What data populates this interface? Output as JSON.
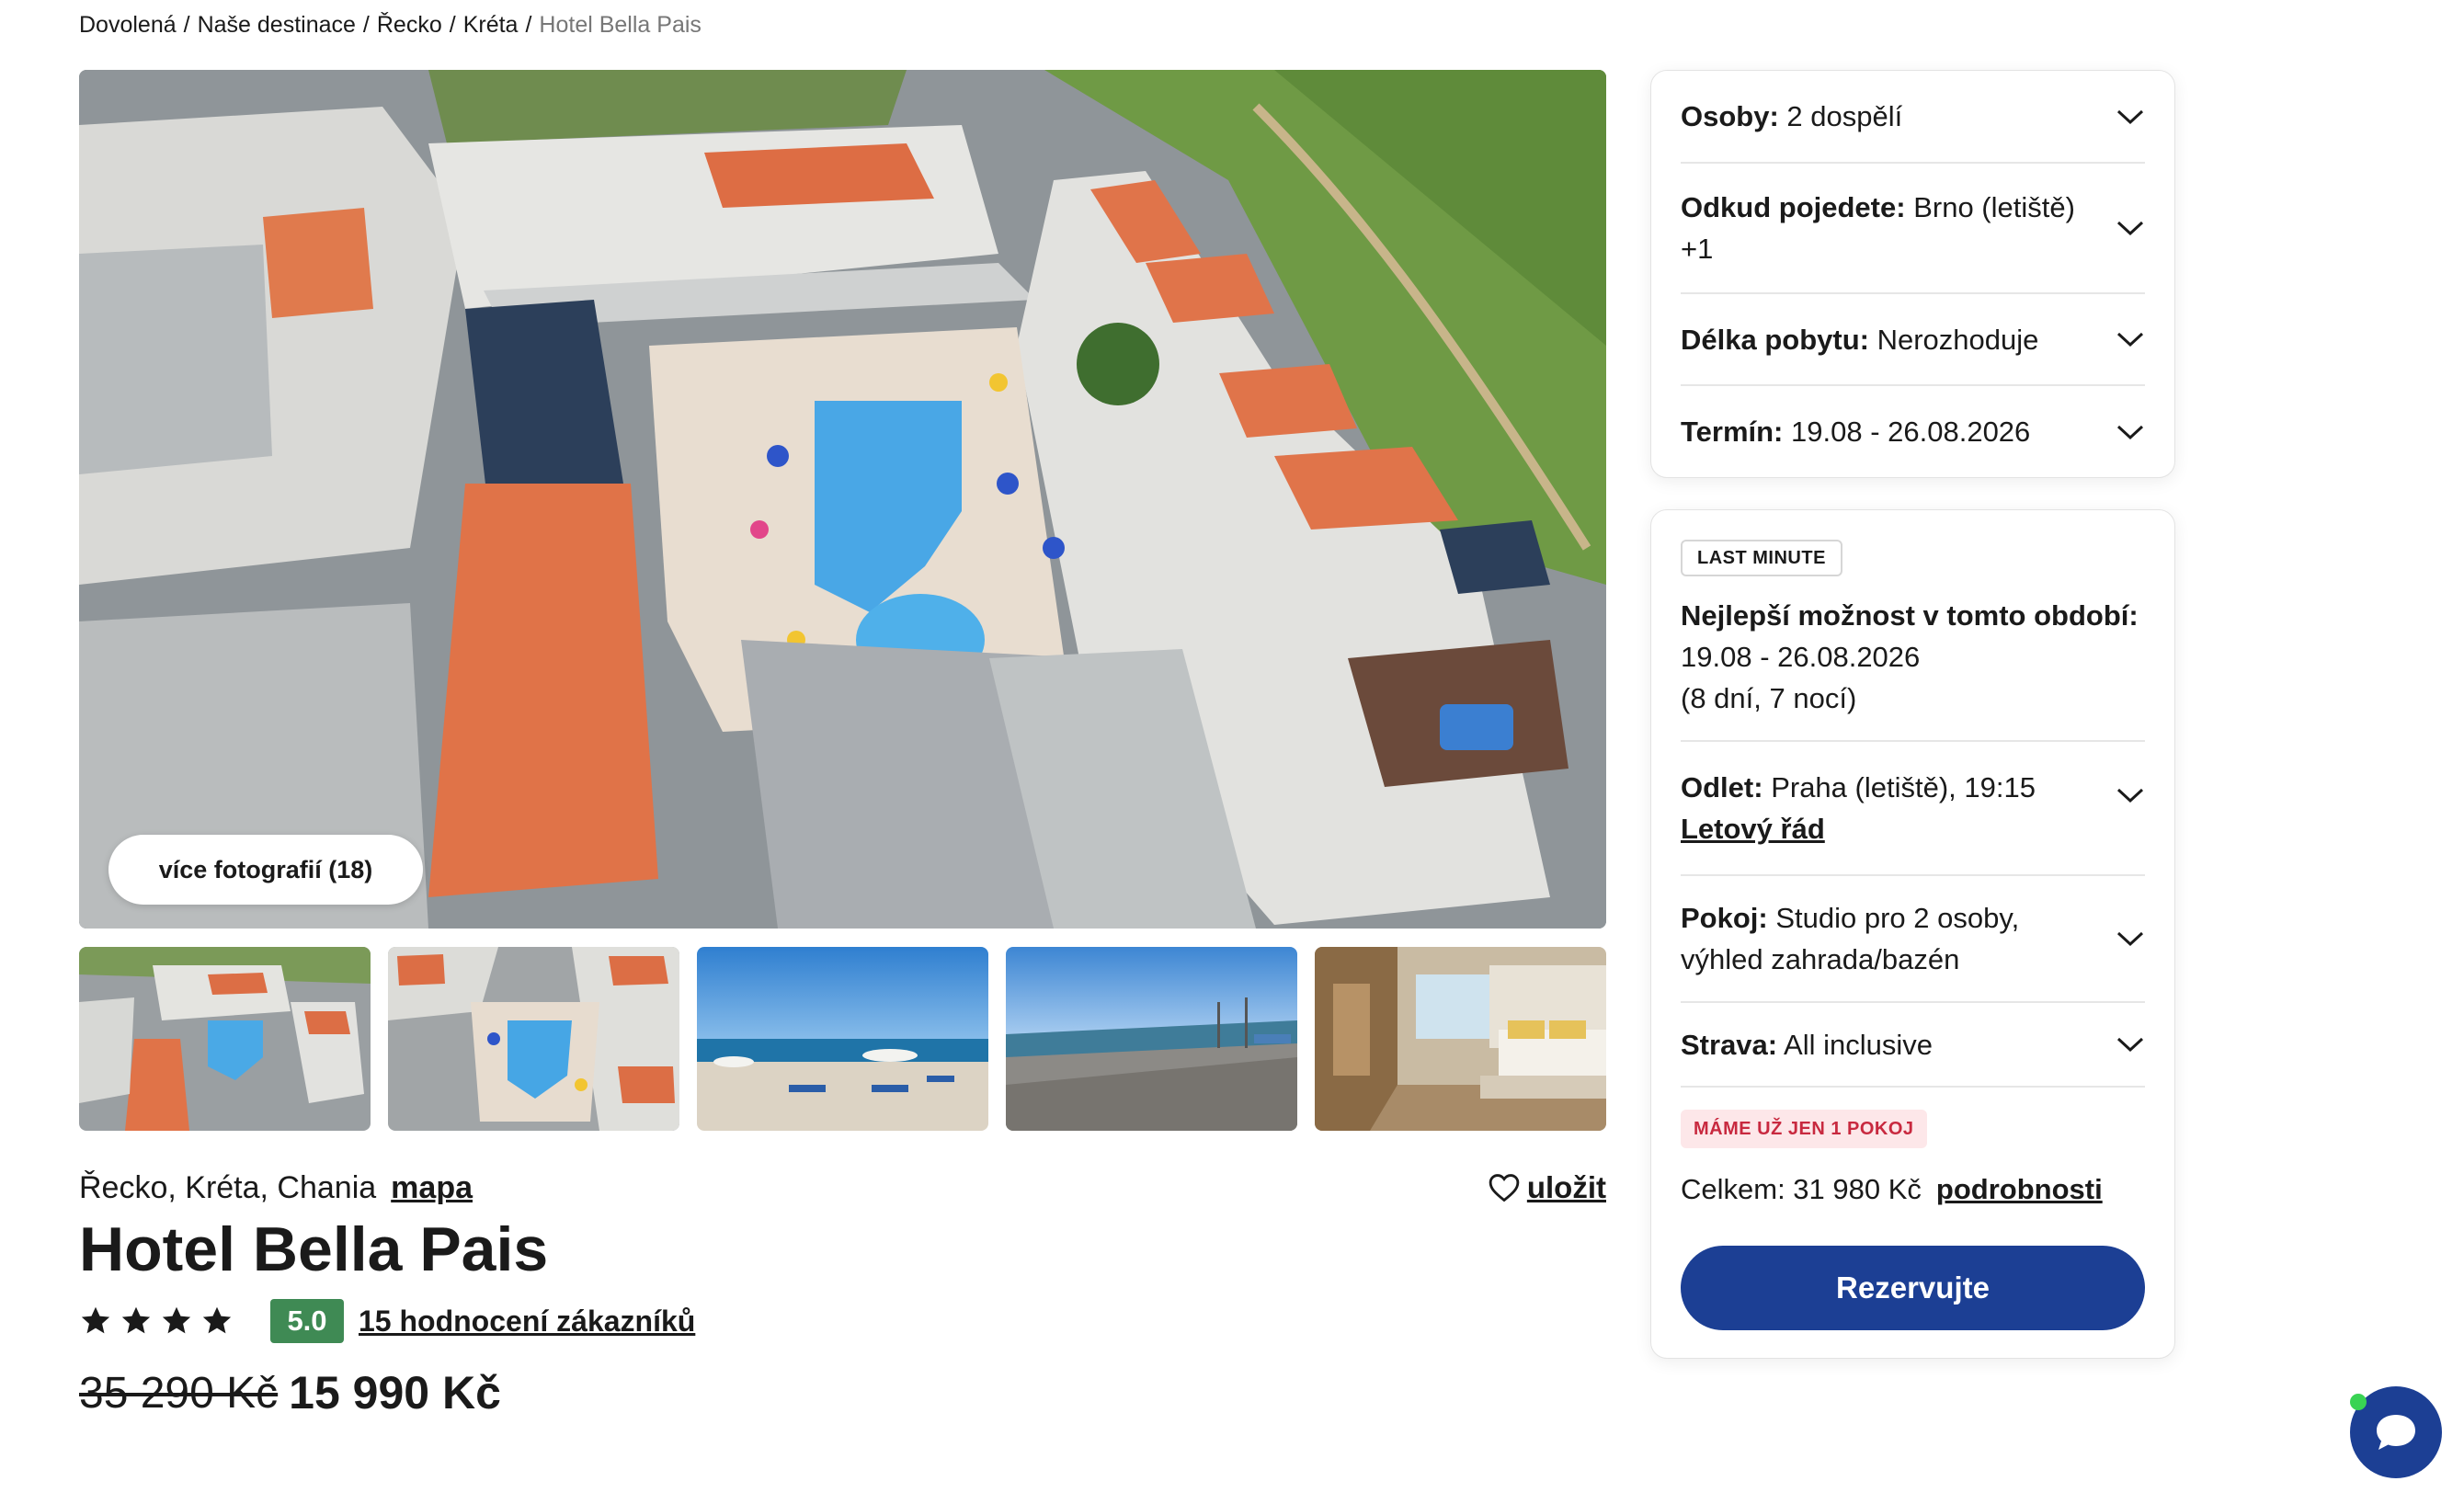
{
  "breadcrumb": [
    "Dovolená",
    "Naše destinace",
    "Řecko",
    "Kréta",
    "Hotel Bella Pais"
  ],
  "gallery": {
    "more_photos_label": "více fotografií (18)",
    "thumbnails": [
      "pool-aerial",
      "pool-aerial-2",
      "beach-umbrellas",
      "pebble-beach",
      "hotel-room"
    ]
  },
  "hotel": {
    "location": "Řecko, Kréta, Chania",
    "map_label": "mapa",
    "save_label": "uložit",
    "name": "Hotel Bella Pais",
    "stars": 4,
    "score": "5.0",
    "reviews_label": "15 hodnocení zákazníků",
    "old_price": "35 290 Kč",
    "new_price": "15 990 Kč"
  },
  "filters": {
    "persons": {
      "label": "Osoby:",
      "value": "2 dospělí"
    },
    "departure": {
      "label": "Odkud pojedete:",
      "value": "Brno (letiště) +1"
    },
    "length": {
      "label": "Délka pobytu:",
      "value": "Nerozhoduje"
    },
    "term": {
      "label": "Termín:",
      "value": "19.08 - 26.08.2026"
    }
  },
  "offer": {
    "badge": "LAST MINUTE",
    "best_label": "Nejlepší možnost v tomto období:",
    "best_dates": "19.08 - 26.08.2026",
    "best_nights": "(8 dní, 7 nocí)",
    "flight": {
      "label": "Odlet:",
      "value": "Praha (letiště), 19:15",
      "link": "Letový řád"
    },
    "room": {
      "label": "Pokoj:",
      "value": "Studio pro 2 osoby, výhled zahrada/bazén"
    },
    "board": {
      "label": "Strava:",
      "value": "All inclusive"
    },
    "rooms_left": "MÁME UŽ JEN 1 POKOJ",
    "total_label": "Celkem: 31 980 Kč",
    "details_label": "podrobnosti",
    "reserve_label": "Rezervujte"
  },
  "colors": {
    "primary": "#1c3f94",
    "score_bg": "#3f8a54",
    "alert": "#c8293f",
    "alert_bg": "#fde7e9",
    "online": "#39d353"
  }
}
